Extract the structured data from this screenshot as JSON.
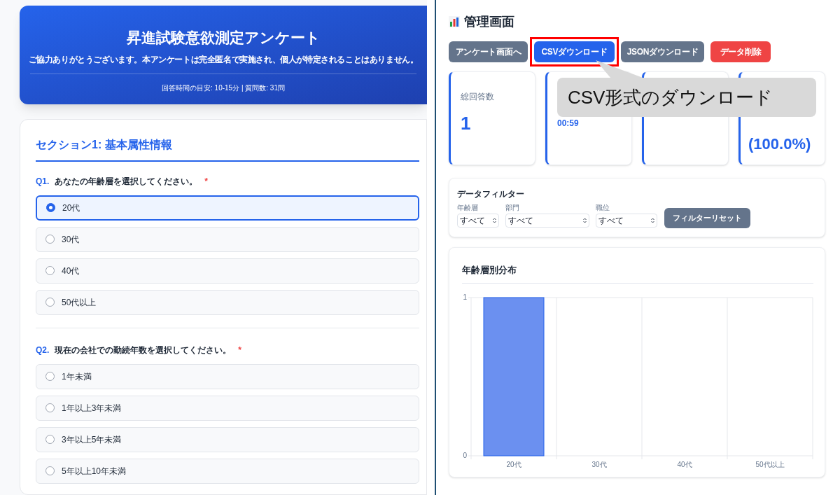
{
  "survey": {
    "title": "昇進試験意欲測定アンケート",
    "intro": "ご協力ありがとうございます。本アンケートは完全匿名で実施され、個人が特定されることはありません。",
    "meta": "回答時間の目安: 10-15分 | 質問数: 31問",
    "section_title": "セクション1: 基本属性情報",
    "questions": [
      {
        "number": "Q1.",
        "text": "あなたの年齢層を選択してください。",
        "required_mark": "*",
        "options": [
          {
            "label": "20代",
            "selected": true
          },
          {
            "label": "30代",
            "selected": false
          },
          {
            "label": "40代",
            "selected": false
          },
          {
            "label": "50代以上",
            "selected": false
          }
        ]
      },
      {
        "number": "Q2.",
        "text": "現在の会社での勤続年数を選択してください。",
        "required_mark": "*",
        "options": [
          {
            "label": "1年未満",
            "selected": false
          },
          {
            "label": "1年以上3年未満",
            "selected": false
          },
          {
            "label": "3年以上5年未満",
            "selected": false
          },
          {
            "label": "5年以上10年未満",
            "selected": false
          }
        ]
      }
    ]
  },
  "admin": {
    "title": "管理画面",
    "buttons": [
      {
        "label": "アンケート画面へ",
        "kind": "neutral",
        "highlighted": false
      },
      {
        "label": "CSVダウンロード",
        "kind": "primary",
        "highlighted": true
      },
      {
        "label": "JSONダウンロード",
        "kind": "neutral",
        "highlighted": false
      },
      {
        "label": "データ削除",
        "kind": "danger",
        "highlighted": false
      }
    ],
    "callout": "CSV形式のダウンロード",
    "stats": [
      {
        "kind": "stat",
        "label": "総回答数",
        "value": "1"
      },
      {
        "kind": "stat",
        "value": "00:59"
      },
      {
        "kind": "stat"
      },
      {
        "kind": "stat",
        "value": "(100.0%)"
      }
    ],
    "filter": {
      "title": "データフィルター",
      "fields": [
        {
          "label": "年齢層",
          "value": "すべて"
        },
        {
          "label": "部門",
          "value": "すべて"
        },
        {
          "label": "職位",
          "value": "すべて"
        }
      ],
      "reset_button": "フィルターリセット"
    },
    "chart": {
      "title": "年齢層別分布",
      "chart_data": {
        "type": "bar",
        "categories": [
          "20代",
          "30代",
          "40代",
          "50代以上"
        ],
        "values": [
          1,
          0,
          0,
          0
        ],
        "ylim": [
          0,
          1
        ],
        "yticks": [
          0,
          1
        ]
      }
    }
  }
}
